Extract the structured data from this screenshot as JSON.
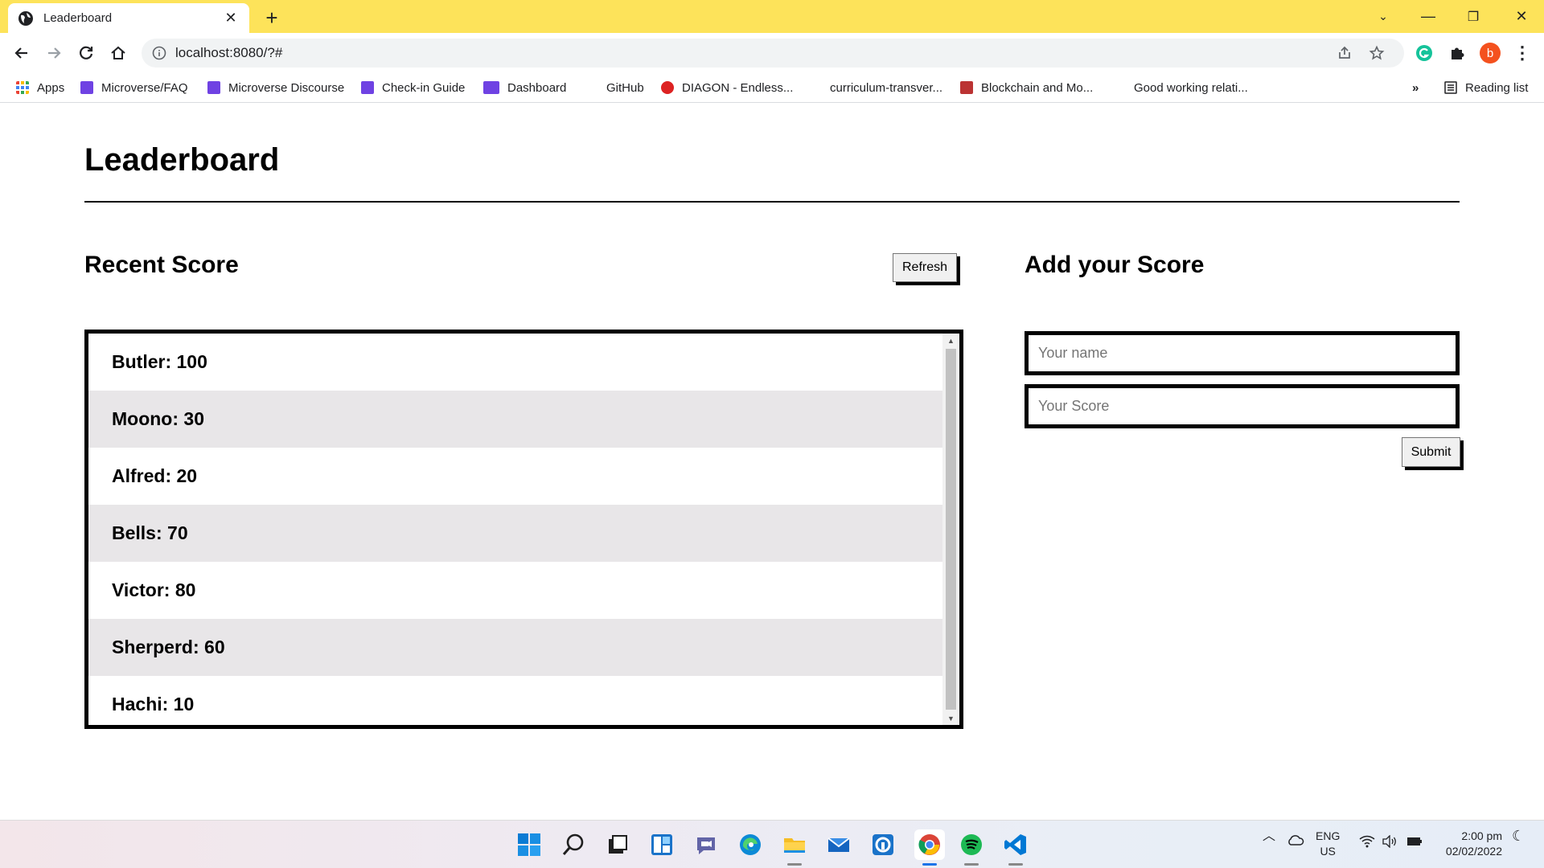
{
  "browser": {
    "tab_title": "Leaderboard",
    "url": "localhost:8080/?#",
    "profile_initial": "b",
    "bookmarks": [
      {
        "label": "Apps",
        "icon": "apps-grid-icon"
      },
      {
        "label": "Microverse/FAQ",
        "icon": "microverse-icon"
      },
      {
        "label": "Microverse Discourse",
        "icon": "microverse-icon"
      },
      {
        "label": "Check-in Guide",
        "icon": "microverse-icon"
      },
      {
        "label": "Dashboard",
        "icon": "microverse-icon"
      },
      {
        "label": "GitHub",
        "icon": "github-icon"
      },
      {
        "label": "DIAGON - Endless...",
        "icon": "diagon-icon"
      },
      {
        "label": "curriculum-transver...",
        "icon": "github-icon"
      },
      {
        "label": "Blockchain and Mo...",
        "icon": "blockchain-icon"
      },
      {
        "label": "Good working relati...",
        "icon": "page-icon"
      }
    ],
    "more_bookmarks": "»",
    "reading_list": "Reading list"
  },
  "page": {
    "title": "Leaderboard",
    "recent": {
      "heading": "Recent Score",
      "refresh_label": "Refresh",
      "scores": [
        "Butler: 100",
        "Moono: 30",
        "Alfred: 20",
        "Bells: 70",
        "Victor: 80",
        "Sherperd: 60",
        "Hachi: 10"
      ]
    },
    "add": {
      "heading": "Add your Score",
      "name_placeholder": "Your name",
      "score_placeholder": "Your Score",
      "submit_label": "Submit"
    }
  },
  "taskbar": {
    "apps": [
      "start-icon",
      "search-icon",
      "task-view-icon",
      "widgets-icon",
      "teams-chat-icon",
      "edge-icon",
      "file-explorer-icon",
      "mail-icon",
      "app-icon",
      "chrome-icon",
      "spotify-icon",
      "vscode-icon"
    ],
    "language": "ENG",
    "region": "US",
    "time": "2:00 pm",
    "date": "02/02/2022"
  },
  "colors": {
    "tabstrip": "#fde35a",
    "row_alt": "#e8e6e8",
    "profile": "#f4511e",
    "grammarly": "#15c39a"
  }
}
